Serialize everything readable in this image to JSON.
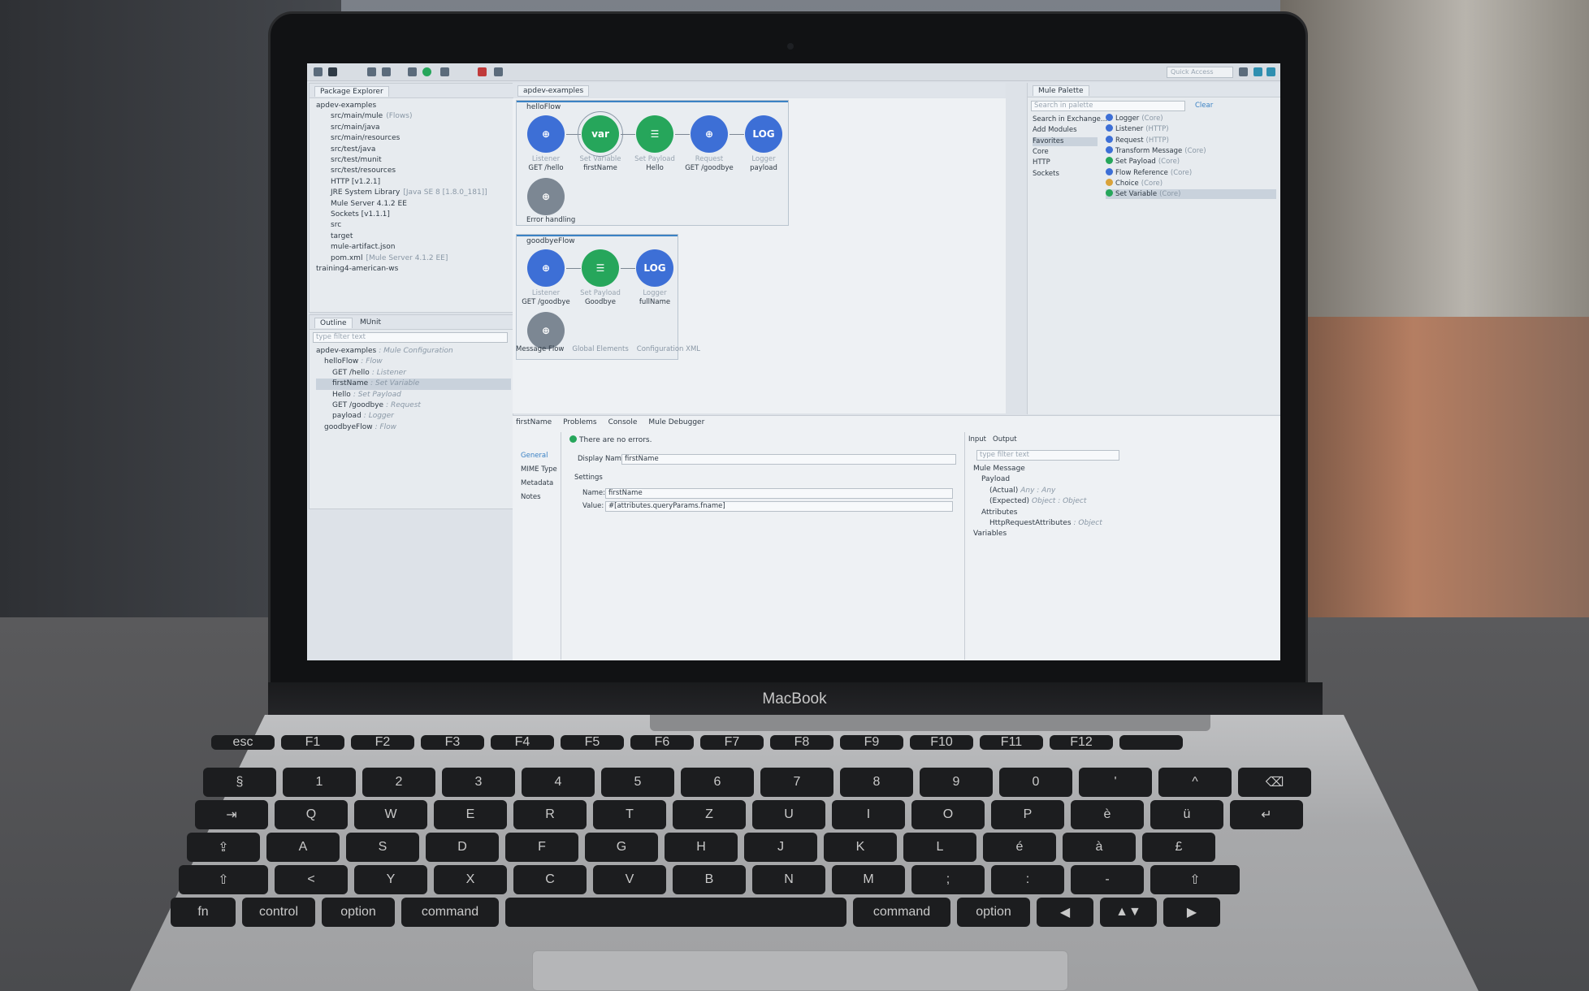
{
  "device": {
    "brand": "MacBook"
  },
  "toolbar": {
    "quick_access": "Quick Access"
  },
  "package_explorer": {
    "tab": "Package Explorer",
    "items": [
      {
        "text": "apdev-examples",
        "note": ""
      },
      {
        "text": "src/main/mule",
        "note": "(Flows)"
      },
      {
        "text": "src/main/java",
        "note": ""
      },
      {
        "text": "src/main/resources",
        "note": ""
      },
      {
        "text": "src/test/java",
        "note": ""
      },
      {
        "text": "src/test/munit",
        "note": ""
      },
      {
        "text": "src/test/resources",
        "note": ""
      },
      {
        "text": "HTTP [v1.2.1]",
        "note": ""
      },
      {
        "text": "JRE System Library",
        "note": "[Java SE 8 [1.8.0_181]]"
      },
      {
        "text": "Mule Server 4.1.2 EE",
        "note": ""
      },
      {
        "text": "Sockets [v1.1.1]",
        "note": ""
      },
      {
        "text": "src",
        "note": ""
      },
      {
        "text": "target",
        "note": ""
      },
      {
        "text": "mule-artifact.json",
        "note": ""
      },
      {
        "text": "pom.xml",
        "note": "[Mule Server 4.1.2 EE]"
      },
      {
        "text": "training4-american-ws",
        "note": ""
      }
    ]
  },
  "outline": {
    "tabs": [
      "Outline",
      "MUnit"
    ],
    "filter_placeholder": "type filter text",
    "items": [
      {
        "text": "apdev-examples",
        "note": ": Mule Configuration"
      },
      {
        "text": "helloFlow",
        "note": ": Flow"
      },
      {
        "text": "GET /hello",
        "note": ": Listener"
      },
      {
        "text": "firstName",
        "note": ": Set Variable"
      },
      {
        "text": "Hello",
        "note": ": Set Payload"
      },
      {
        "text": "GET /goodbye",
        "note": ": Request"
      },
      {
        "text": "payload",
        "note": ": Logger"
      },
      {
        "text": "goodbyeFlow",
        "note": ": Flow"
      }
    ]
  },
  "editor": {
    "tab": "apdev-examples",
    "bottom_tabs": [
      "Message Flow",
      "Global Elements",
      "Configuration XML"
    ],
    "flows": [
      {
        "name": "helloFlow",
        "nodes": [
          {
            "type": "Listener",
            "label": "GET /hello",
            "icon": "globe-icon",
            "color": "#3d6fd6"
          },
          {
            "type": "Set Variable",
            "label": "firstName",
            "icon": "var",
            "color": "#26a65b"
          },
          {
            "type": "Set Payload",
            "label": "Hello",
            "icon": "payload-icon",
            "color": "#26a65b"
          },
          {
            "type": "Request",
            "label": "GET /goodbye",
            "icon": "globe-icon",
            "color": "#3d6fd6"
          },
          {
            "type": "Logger",
            "label": "payload",
            "icon": "LOG",
            "color": "#3d6fd6"
          }
        ],
        "error": "Error handling"
      },
      {
        "name": "goodbyeFlow",
        "nodes": [
          {
            "type": "Listener",
            "label": "GET /goodbye",
            "icon": "globe-icon",
            "color": "#3d6fd6"
          },
          {
            "type": "Set Payload",
            "label": "Goodbye",
            "icon": "payload-icon",
            "color": "#26a65b"
          },
          {
            "type": "Logger",
            "label": "fullName",
            "icon": "LOG",
            "color": "#3d6fd6"
          }
        ]
      }
    ]
  },
  "palette": {
    "tab": "Mule Palette",
    "search_placeholder": "Search in palette",
    "clear": "Clear",
    "left": [
      "Search in Exchange...",
      "Add Modules",
      "Favorites",
      "Core",
      "HTTP",
      "Sockets"
    ],
    "right": [
      {
        "name": "Logger",
        "note": "(Core)"
      },
      {
        "name": "Listener",
        "note": "(HTTP)"
      },
      {
        "name": "Request",
        "note": "(HTTP)"
      },
      {
        "name": "Transform Message",
        "note": "(Core)"
      },
      {
        "name": "Set Payload",
        "note": "(Core)"
      },
      {
        "name": "Flow Reference",
        "note": "(Core)"
      },
      {
        "name": "Choice",
        "note": "(Core)"
      },
      {
        "name": "Set Variable",
        "note": "(Core)"
      }
    ]
  },
  "properties": {
    "tabs": [
      "firstName",
      "Problems",
      "Console",
      "Mule Debugger"
    ],
    "sidebar": [
      "General",
      "MIME Type",
      "Metadata",
      "Notes"
    ],
    "status": "There are no errors.",
    "display_name_label": "Display Name:",
    "display_name": "firstName",
    "settings": "Settings",
    "name_label": "Name:",
    "name": "firstName",
    "value_label": "Value:",
    "value": "#[attributes.queryParams.fname]",
    "meta_tabs": [
      "Input",
      "Output"
    ],
    "meta_filter": "type filter text",
    "meta_tree": [
      {
        "text": "Mule Message",
        "note": ""
      },
      {
        "text": "Payload",
        "note": ""
      },
      {
        "text": "(Actual)",
        "note": "Any : Any"
      },
      {
        "text": "(Expected)",
        "note": "Object : Object"
      },
      {
        "text": "Attributes",
        "note": ""
      },
      {
        "text": "HttpRequestAttributes",
        "note": ": Object"
      },
      {
        "text": "Variables",
        "note": ""
      }
    ]
  },
  "keyboard": {
    "rows": [
      [
        "esc",
        "F1",
        "F2",
        "F3",
        "F4",
        "F5",
        "F6",
        "F7",
        "F8",
        "F9",
        "F10",
        "F11",
        "F12",
        ""
      ],
      [
        "§",
        "1",
        "2",
        "3",
        "4",
        "5",
        "6",
        "7",
        "8",
        "9",
        "0",
        "'",
        "^",
        "⌫"
      ],
      [
        "⇥",
        "Q",
        "W",
        "E",
        "R",
        "T",
        "Z",
        "U",
        "I",
        "O",
        "P",
        "è",
        "ü",
        "↵"
      ],
      [
        "⇪",
        "A",
        "S",
        "D",
        "F",
        "G",
        "H",
        "J",
        "K",
        "L",
        "é",
        "à",
        "£"
      ],
      [
        "⇧",
        "<",
        "Y",
        "X",
        "C",
        "V",
        "B",
        "N",
        "M",
        ";",
        ":",
        "-",
        "⇧"
      ],
      [
        "fn",
        "control",
        "option",
        "command",
        "",
        "command",
        "option",
        "◀",
        "▲▼",
        "▶"
      ]
    ]
  }
}
